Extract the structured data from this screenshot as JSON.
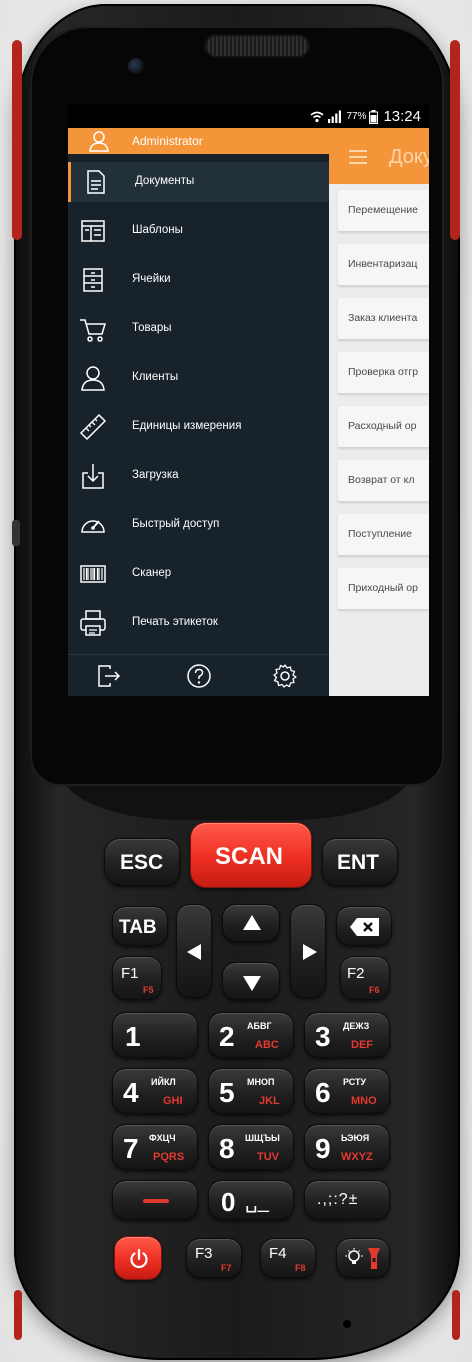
{
  "status_bar": {
    "wifi_icon": "wifi-icon",
    "signal_icon": "signal-icon",
    "battery_percent": "77%",
    "battery_icon": "battery-icon",
    "time": "13:24"
  },
  "drawer": {
    "user": "Administrator",
    "items": [
      {
        "label": "Документы",
        "icon": "document-icon"
      },
      {
        "label": "Шаблоны",
        "icon": "template-icon"
      },
      {
        "label": "Ячейки",
        "icon": "cabinet-icon"
      },
      {
        "label": "Товары",
        "icon": "cart-icon"
      },
      {
        "label": "Клиенты",
        "icon": "person-icon"
      },
      {
        "label": "Единицы измерения",
        "icon": "ruler-icon"
      },
      {
        "label": "Загрузка",
        "icon": "download-icon"
      },
      {
        "label": "Быстрый доступ",
        "icon": "speedometer-icon"
      },
      {
        "label": "Сканер",
        "icon": "barcode-icon"
      },
      {
        "label": "Печать этикеток",
        "icon": "printer-icon"
      }
    ],
    "footer_icons": [
      "logout-icon",
      "help-icon",
      "settings-icon"
    ]
  },
  "documents": {
    "title": "Доку",
    "items": [
      "Перемещение",
      "Инвентаризац",
      "Заказ клиента",
      "Проверка отгр",
      "Расходный ор",
      "Возврат от кл",
      "Поступление",
      "Приходный ор"
    ]
  },
  "keypad": {
    "esc": "ESC",
    "scan": "SCAN",
    "ent": "ENT",
    "tab": "TAB",
    "f1": "F1",
    "f5": "F5",
    "f2": "F2",
    "f6": "F6",
    "f3": "F3",
    "f7": "F7",
    "f4": "F4",
    "f8": "F8",
    "k1": "1",
    "k2": "2",
    "k2_cyr": "АБВГ",
    "k2_lat": "ABC",
    "k3": "3",
    "k3_cyr": "ДЕЖЗ",
    "k3_lat": "DEF",
    "k4": "4",
    "k4_cyr": "ИЙКЛ",
    "k4_lat": "GHI",
    "k5": "5",
    "k5_cyr": "МНОП",
    "k5_lat": "JKL",
    "k6": "6",
    "k6_cyr": "РСТУ",
    "k6_lat": "MNO",
    "k7": "7",
    "k7_cyr": "ФХЦЧ",
    "k7_lat": "PQRS",
    "k8": "8",
    "k8_cyr": "ШЩЪЫ",
    "k8_lat": "TUV",
    "k9": "9",
    "k9_cyr": "ЬЭЮЯ",
    "k9_lat": "WXYZ",
    "k0": "0",
    "k0_sym": "␣_",
    "punct": ".,;:?±"
  },
  "colors": {
    "accent": "#f4953a",
    "drawer_bg": "#17222a",
    "scan_key": "#ee2e22"
  }
}
